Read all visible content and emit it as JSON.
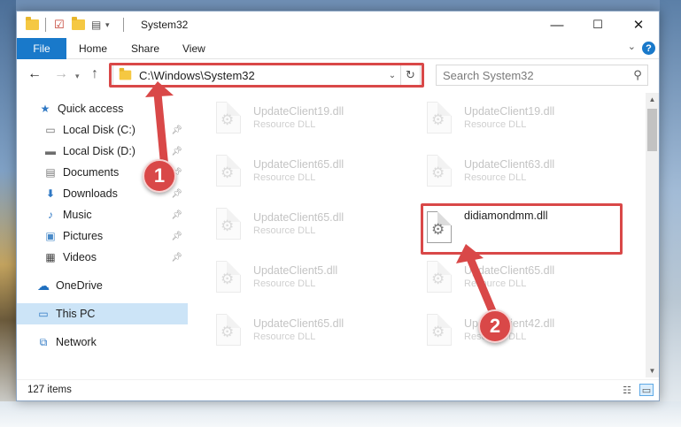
{
  "window": {
    "title": "System32",
    "controls": {
      "minimize": "—",
      "maximize": "☐",
      "close": "✕"
    }
  },
  "ribbon": {
    "tabs": [
      "File",
      "Home",
      "Share",
      "View"
    ],
    "help": "?"
  },
  "address_bar": {
    "path": "C:\\Windows\\System32",
    "search_placeholder": "Search System32"
  },
  "nav_pane": {
    "items": [
      {
        "label": "Quick access",
        "icon": "star-icon",
        "pinned": false
      },
      {
        "label": "Local Disk (C:)",
        "icon": "drive-icon",
        "pinned": true
      },
      {
        "label": "Local Disk (D:)",
        "icon": "drive-icon",
        "pinned": true
      },
      {
        "label": "Documents",
        "icon": "documents-icon",
        "pinned": true
      },
      {
        "label": "Downloads",
        "icon": "download-icon",
        "pinned": true
      },
      {
        "label": "Music",
        "icon": "music-icon",
        "pinned": true
      },
      {
        "label": "Pictures",
        "icon": "pictures-icon",
        "pinned": true
      },
      {
        "label": "Videos",
        "icon": "videos-icon",
        "pinned": true
      },
      {
        "label": "OneDrive",
        "icon": "cloud-icon",
        "pinned": false
      },
      {
        "label": "This PC",
        "icon": "pc-icon",
        "pinned": false,
        "selected": true
      },
      {
        "label": "Network",
        "icon": "network-icon",
        "pinned": false
      }
    ]
  },
  "files": [
    {
      "name": "UpdateClient19.dll",
      "type": "Resource DLL",
      "dim": true
    },
    {
      "name": "UpdateClient19.dll",
      "type": "Resource DLL",
      "dim": true
    },
    {
      "name": "UpdateClient65.dll",
      "type": "Resource DLL",
      "dim": true
    },
    {
      "name": "UpdateClient63.dll",
      "type": "Resource DLL",
      "dim": true
    },
    {
      "name": "UpdateClient65.dll",
      "type": "Resource DLL",
      "dim": true
    },
    {
      "name": "didiamondmm.dll",
      "type": "",
      "dim": false
    },
    {
      "name": "UpdateClient5.dll",
      "type": "Resource DLL",
      "dim": true
    },
    {
      "name": "UpdateClient65.dll",
      "type": "Resource DLL",
      "dim": true
    },
    {
      "name": "UpdateClient65.dll",
      "type": "Resource DLL",
      "dim": true
    },
    {
      "name": "UpdateClient42.dll",
      "type": "Resource DLL",
      "dim": true
    }
  ],
  "status_bar": {
    "item_count": "127 items"
  },
  "annotations": {
    "step1": "1",
    "step2": "2",
    "color": "#d94848"
  }
}
